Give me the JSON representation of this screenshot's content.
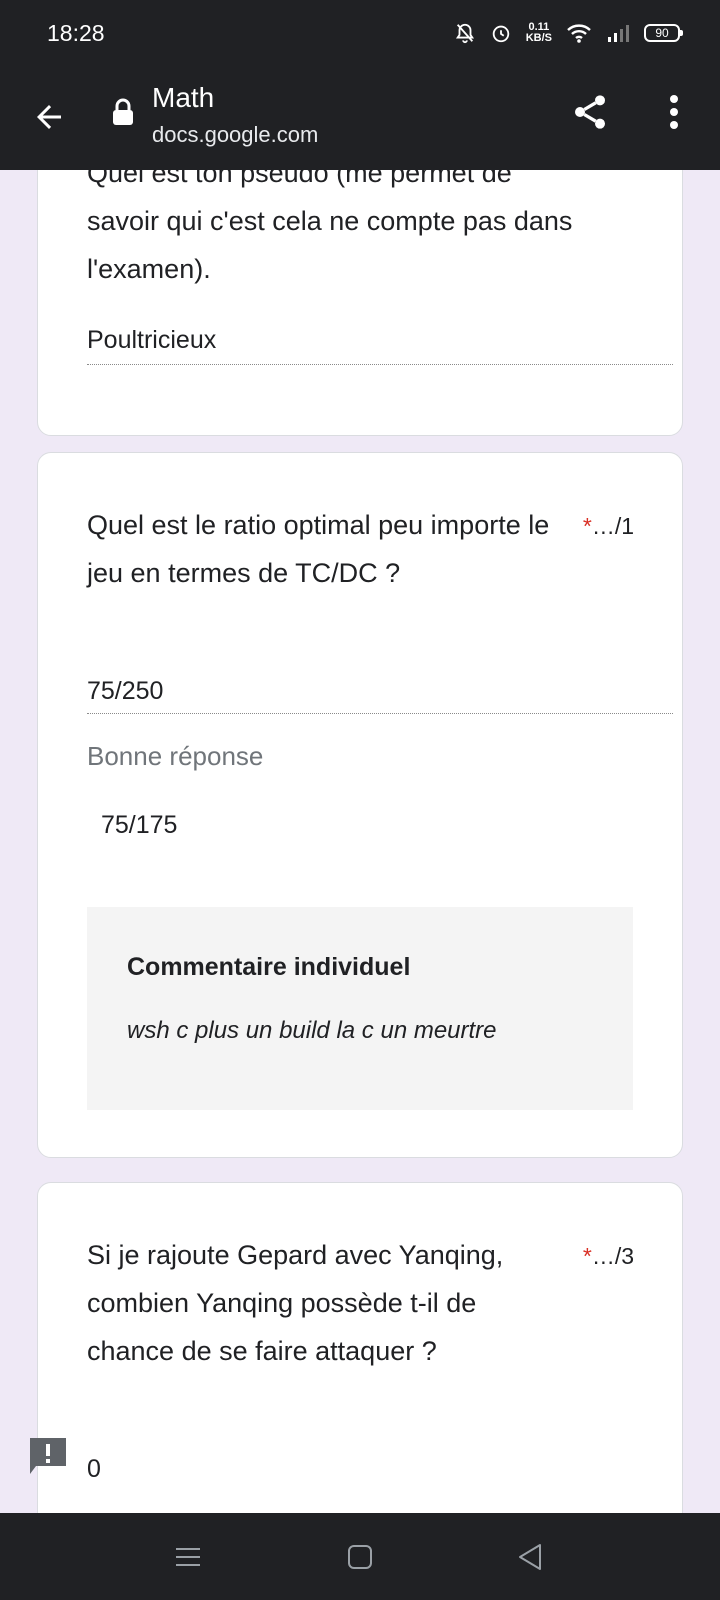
{
  "status_bar": {
    "time": "18:28",
    "net_speed_value": "0.11",
    "net_speed_unit": "KB/S",
    "battery": "90"
  },
  "browser": {
    "title": "Math",
    "url": "docs.google.com"
  },
  "cards": [
    {
      "question": "Quel est ton pseudo (me permet de savoir qui c'est cela ne compte pas dans l'examen).",
      "answer": "Poultricieux"
    },
    {
      "question": "Quel est le ratio optimal peu importe le jeu en termes de TC/DC ?",
      "required": "*",
      "points": "…/1",
      "answer": "75/250",
      "correct_label": "Bonne réponse",
      "correct_answer": "75/175",
      "feedback_title": "Commentaire individuel",
      "feedback_text": "wsh c plus un build la c un meurtre"
    },
    {
      "question": "Si je rajoute Gepard avec Yanqing, combien Yanqing possède t-il de chance de se faire attaquer ?",
      "required": "*",
      "points": "…/3",
      "answer": "0"
    }
  ]
}
